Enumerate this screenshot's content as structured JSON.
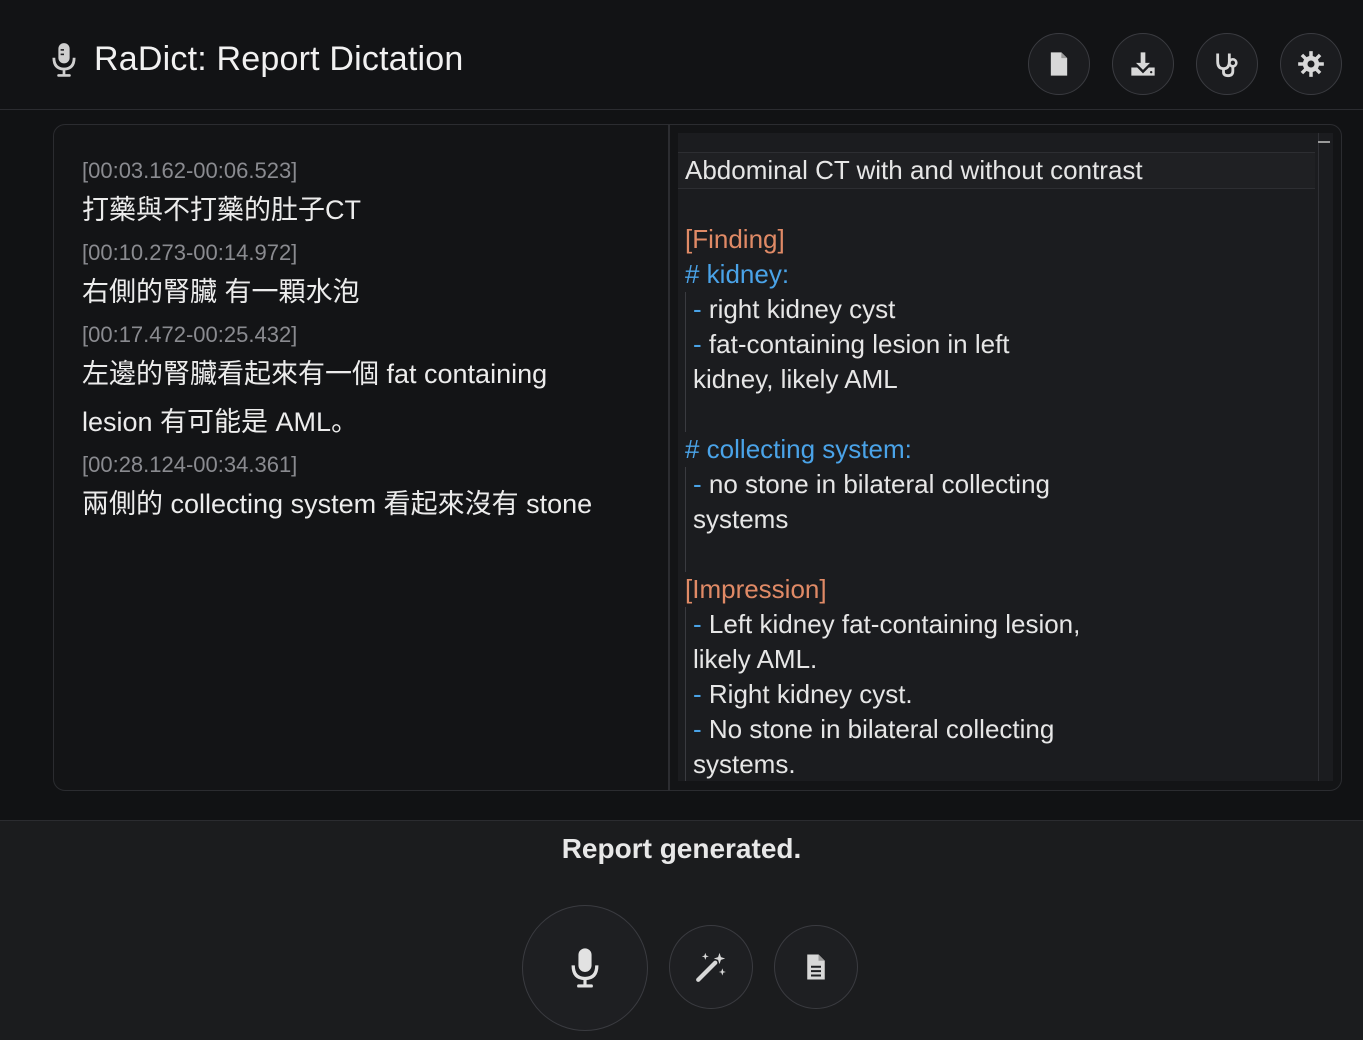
{
  "header": {
    "title": "RaDict: Report Dictation",
    "buttons": [
      "document-icon",
      "download-icon",
      "stethoscope-icon",
      "settings-icon"
    ]
  },
  "transcript": [
    {
      "time": "[00:03.162-00:06.523]",
      "text": "打藥與不打藥的肚子CT"
    },
    {
      "time": "[00:10.273-00:14.972]",
      "text": "右側的腎臟 有一顆水泡"
    },
    {
      "time": "[00:17.472-00:25.432]",
      "text": "左邊的腎臟看起來有一個 fat containing",
      "text2": "lesion 有可能是 AML。"
    },
    {
      "time": "[00:28.124-00:34.361]",
      "text": "兩側的 collecting system 看起來沒有 stone"
    }
  ],
  "report": {
    "line1": "Abdominal CT with and without contrast",
    "finding_heading": "[Finding]",
    "kidney_heading": "# kidney:",
    "kidney_item1": "right kidney cyst",
    "kidney_item2a": "fat-containing lesion in left",
    "kidney_item2b": "kidney, likely AML",
    "collecting_heading": "# collecting system:",
    "collecting_item1a": "no stone in bilateral collecting",
    "collecting_item1b": "systems",
    "impression_heading": "[Impression]",
    "imp1a": "Left kidney fat-containing lesion,",
    "imp1b": "likely AML.",
    "imp2": "Right kidney cyst.",
    "imp3a": "No stone in bilateral collecting",
    "imp3b": "systems.",
    "dash": "-"
  },
  "status": "Report generated.",
  "bottom_buttons": [
    "microphone-icon",
    "magic-wand-icon",
    "report-icon"
  ],
  "colors": {
    "background": "#111214",
    "heading_orange": "#e08a66",
    "heading_blue": "#4aa3e8"
  }
}
